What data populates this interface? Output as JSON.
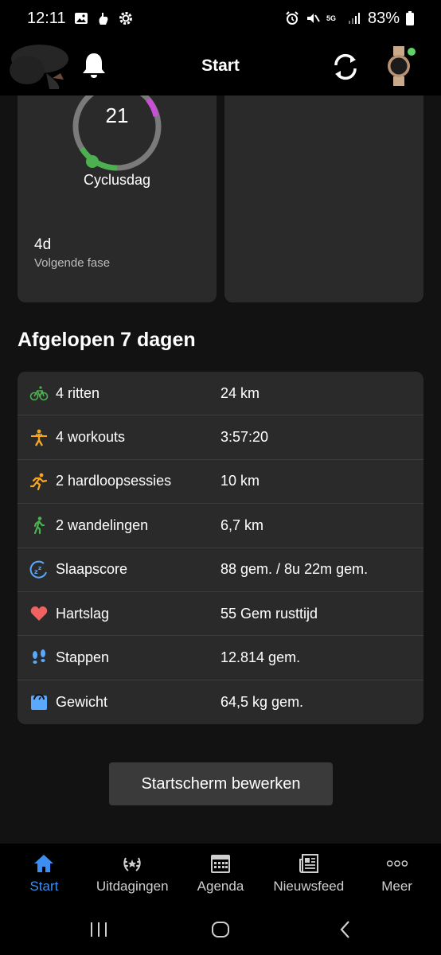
{
  "status_bar": {
    "time": "12:11",
    "battery": "83%",
    "network": "5G"
  },
  "app_bar": {
    "title": "Start"
  },
  "cycle_card": {
    "day_number": "21",
    "label": "Cyclusdag",
    "days_value": "4d",
    "days_caption": "Volgende fase"
  },
  "section": {
    "title": "Afgelopen 7 dagen"
  },
  "stats": [
    {
      "icon": "bike-icon",
      "label": "4 ritten",
      "value": "24 km",
      "color": "#4caf50"
    },
    {
      "icon": "workout-icon",
      "label": "4 workouts",
      "value": "3:57:20",
      "color": "#f5a623"
    },
    {
      "icon": "running-icon",
      "label": "2 hardloopsessies",
      "value": "10 km",
      "color": "#f5a623"
    },
    {
      "icon": "walking-icon",
      "label": "2 wandelingen",
      "value": "6,7 km",
      "color": "#4caf50"
    },
    {
      "icon": "sleep-icon",
      "label": "Slaapscore",
      "value": "88 gem. / 8u 22m gem.",
      "color": "#5aa9ff"
    },
    {
      "icon": "heart-icon",
      "label": "Hartslag",
      "value": "55 Gem rusttijd",
      "color": "#f06262"
    },
    {
      "icon": "footsteps-icon",
      "label": "Stappen",
      "value": "12.814 gem.",
      "color": "#5aa9ff"
    },
    {
      "icon": "scale-icon",
      "label": "Gewicht",
      "value": "64,5 kg gem.",
      "color": "#5aa9ff"
    }
  ],
  "edit_button": {
    "label": "Startscherm bewerken"
  },
  "bottom_nav": [
    {
      "label": "Start",
      "icon": "home-icon",
      "active": true
    },
    {
      "label": "Uitdagingen",
      "icon": "laurel-icon",
      "active": false
    },
    {
      "label": "Agenda",
      "icon": "calendar-icon",
      "active": false
    },
    {
      "label": "Nieuwsfeed",
      "icon": "newsfeed-icon",
      "active": false
    },
    {
      "label": "Meer",
      "icon": "more-icon",
      "active": false
    }
  ],
  "colors": {
    "accent": "#3d8ef0",
    "card": "#2a2a2a",
    "background": "#121212"
  }
}
